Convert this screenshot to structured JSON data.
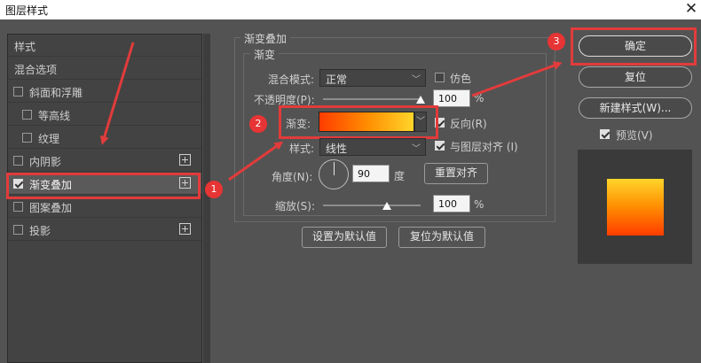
{
  "window": {
    "title": "图层样式",
    "close_glyph": "✕"
  },
  "sidebar": {
    "items": [
      {
        "label": "样式"
      },
      {
        "label": "混合选项"
      },
      {
        "label": "斜面和浮雕",
        "checked": false
      },
      {
        "label": "等高线",
        "checked": false
      },
      {
        "label": "纹理",
        "checked": false
      },
      {
        "label": "内阴影",
        "checked": false,
        "plus": "+"
      },
      {
        "label": "渐变叠加",
        "checked": true,
        "plus": "+"
      },
      {
        "label": "图案叠加",
        "checked": false
      },
      {
        "label": "投影",
        "checked": false,
        "plus": "+"
      }
    ]
  },
  "panel": {
    "section_title": "渐变叠加",
    "fieldset_title": "渐变",
    "blend_mode_label": "混合模式:",
    "blend_mode_value": "正常",
    "dither_label": "仿色",
    "dither_checked": false,
    "opacity_label": "不透明度(P):",
    "opacity_value": "100",
    "percent": "%",
    "opacity_fraction": 1.0,
    "gradient_label": "渐变:",
    "gradient_colors": [
      "#ff3c00",
      "#ff8c00",
      "#ffd52a"
    ],
    "reverse_label": "反向(R)",
    "reverse_checked": true,
    "style_label": "样式:",
    "style_value": "线性",
    "align_label": "与图层对齐 (I)",
    "align_checked": true,
    "angle_label": "角度(N):",
    "angle_value": "90",
    "degree_label": "度",
    "reset_align_label": "重置对齐",
    "scale_label": "缩放(S):",
    "scale_value": "100",
    "scale_fraction": 0.65,
    "set_default_label": "设置为默认值",
    "reset_default_label": "复位为默认值"
  },
  "right": {
    "ok_label": "确定",
    "reset_label": "复位",
    "new_style_label": "新建样式(W)...",
    "preview_label": "预览(V)",
    "preview_checked": true
  },
  "annotations": {
    "badge1": "1",
    "badge2": "2",
    "badge3": "3",
    "accent": "#e23b3b"
  }
}
